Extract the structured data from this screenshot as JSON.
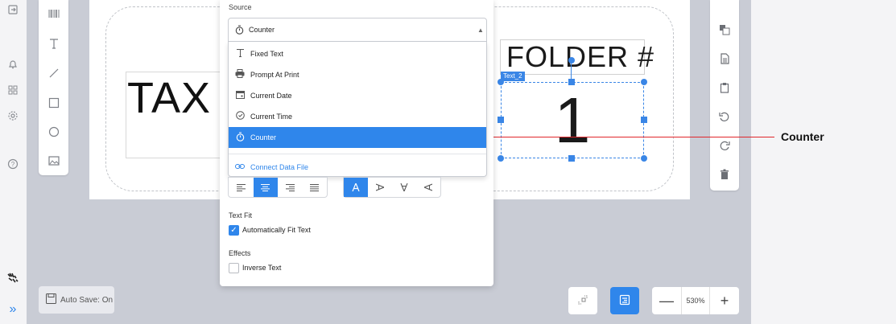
{
  "icons": {
    "left_rail": [
      "export-icon",
      "notification-bell-icon",
      "grid-icon",
      "settings-gear-icon",
      "help-icon",
      "brand-logo-icon",
      "expand-chevrons-icon"
    ],
    "tools": [
      "barcode-tool-icon",
      "text-tool-icon",
      "line-tool-icon",
      "rectangle-tool-icon",
      "ellipse-tool-icon",
      "image-tool-icon"
    ],
    "actions": [
      "bring-to-front-icon",
      "copy-icon",
      "paste-icon",
      "undo-icon",
      "redo-icon",
      "delete-icon"
    ]
  },
  "canvas": {
    "tax_text": "TAX",
    "folder_text": "FOLDER #",
    "counter_value": "1",
    "selected_object_tag": "Text_2"
  },
  "properties": {
    "source_label": "Source",
    "source_selected": "Counter",
    "source_options": [
      {
        "label": "Fixed Text",
        "icon": "fixed-text-icon"
      },
      {
        "label": "Prompt At Print",
        "icon": "printer-icon"
      },
      {
        "label": "Current Date",
        "icon": "calendar-icon"
      },
      {
        "label": "Current Time",
        "icon": "clock-icon"
      },
      {
        "label": "Counter",
        "icon": "stopwatch-icon",
        "active": true
      }
    ],
    "connect_data_file": "Connect Data File",
    "text_fit_label": "Text Fit",
    "auto_fit_label": "Automatically Fit Text",
    "auto_fit_checked": true,
    "effects_label": "Effects",
    "inverse_text_label": "Inverse Text",
    "inverse_text_checked": false
  },
  "annotation": {
    "label": "Counter",
    "color": "#e0262b"
  },
  "footer": {
    "autosave_label": "Auto Save: On",
    "zoom_value": "530%"
  },
  "colors": {
    "accent": "#2f86eb",
    "selection": "#3a86e6",
    "canvas_bg": "#c9ccd5"
  }
}
